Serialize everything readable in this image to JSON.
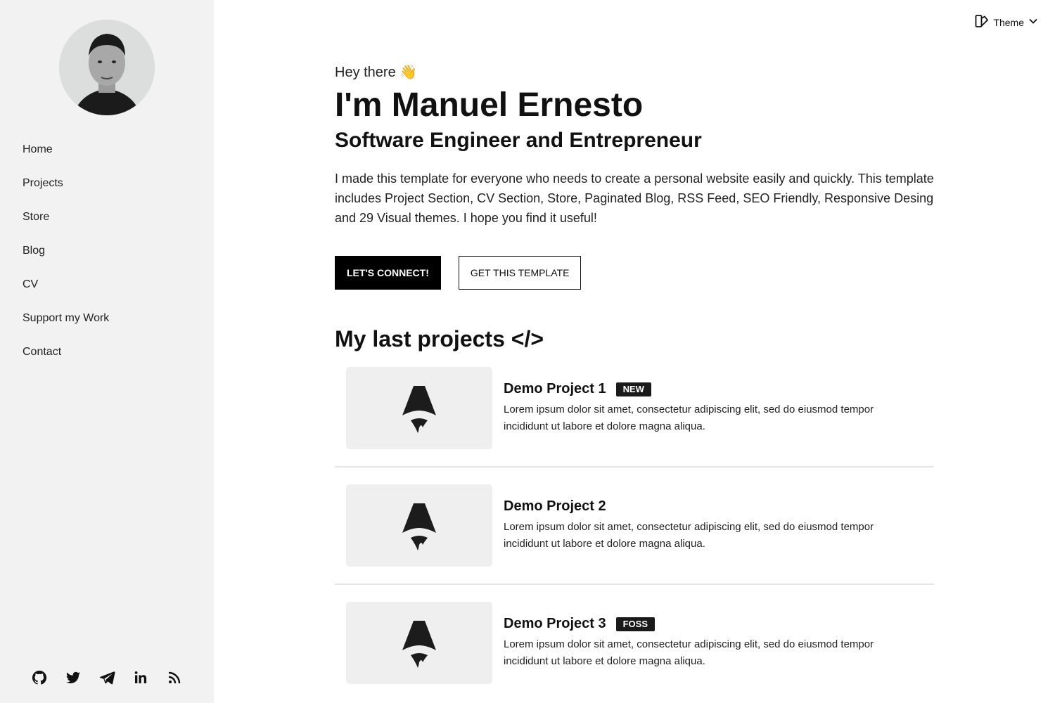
{
  "sidebar": {
    "nav": [
      "Home",
      "Projects",
      "Store",
      "Blog",
      "CV",
      "Support my Work",
      "Contact"
    ],
    "socials": [
      "github-icon",
      "twitter-icon",
      "telegram-icon",
      "linkedin-icon",
      "rss-icon"
    ]
  },
  "header": {
    "theme_label": "Theme"
  },
  "hero": {
    "greeting": "Hey there 👋",
    "name": "I'm Manuel Ernesto",
    "role": "Software Engineer and Entrepreneur",
    "intro": "I made this template for everyone who needs to create a personal website easily and quickly. This template includes Project Section, CV Section, Store, Paginated Blog, RSS Feed, SEO Friendly, Responsive Desing and 29 Visual themes. I hope you find it useful!",
    "primary_button": "LET'S CONNECT!",
    "secondary_button": "GET THIS TEMPLATE"
  },
  "projects_section": {
    "title": "My last projects </>",
    "items": [
      {
        "title": "Demo Project 1",
        "badge": "NEW",
        "description": "Lorem ipsum dolor sit amet, consectetur adipiscing elit, sed do eiusmod tempor incididunt ut labore et dolore magna aliqua."
      },
      {
        "title": "Demo Project 2",
        "badge": "",
        "description": "Lorem ipsum dolor sit amet, consectetur adipiscing elit, sed do eiusmod tempor incididunt ut labore et dolore magna aliqua."
      },
      {
        "title": "Demo Project 3",
        "badge": "FOSS",
        "description": "Lorem ipsum dolor sit amet, consectetur adipiscing elit, sed do eiusmod tempor incididunt ut labore et dolore magna aliqua."
      }
    ]
  }
}
